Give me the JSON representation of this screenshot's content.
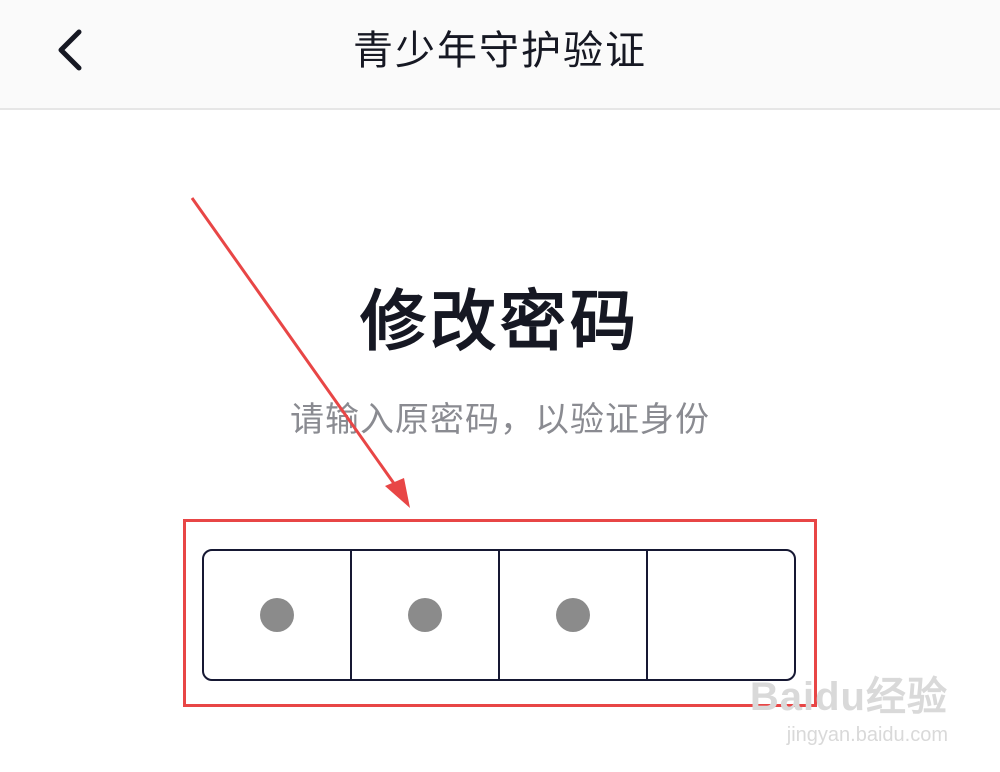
{
  "header": {
    "title": "青少年守护验证",
    "back_icon": "chevron-left-icon"
  },
  "main": {
    "heading": "修改密码",
    "subtitle": "请输入原密码，以验证身份"
  },
  "pin": {
    "length": 4,
    "filled": [
      true,
      true,
      true,
      false
    ]
  },
  "annotation": {
    "color": "#e84646"
  },
  "watermark": {
    "brand": "Baidu经验",
    "url": "jingyan.baidu.com"
  },
  "colors": {
    "text_primary": "#161823",
    "text_secondary": "#8a8b91",
    "pin_border": "#161833",
    "pin_dot": "#8b8b8b"
  }
}
